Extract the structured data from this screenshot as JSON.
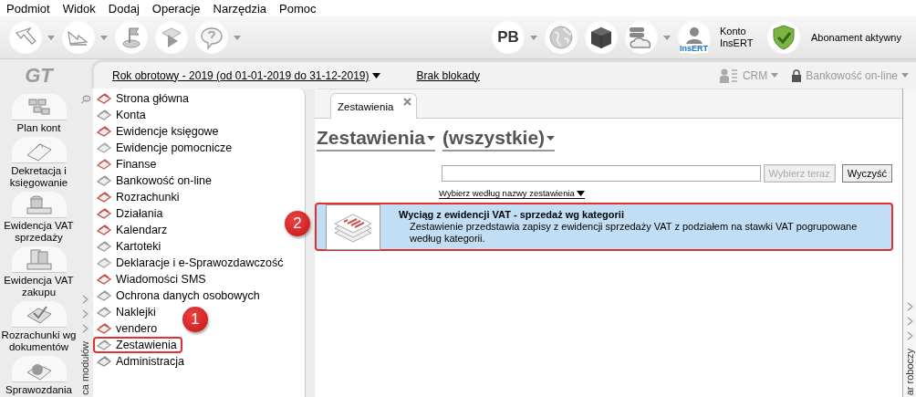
{
  "menu": [
    "Podmiot",
    "Widok",
    "Dodaj",
    "Operacje",
    "Narzędzia",
    "Pomoc"
  ],
  "toolbar": {
    "left": [
      {
        "kind": "send",
        "dropdown": true
      },
      {
        "kind": "receive",
        "dropdown": true
      },
      {
        "kind": "flag",
        "dropdown": false
      },
      {
        "kind": "play",
        "dropdown": false
      },
      {
        "kind": "help",
        "dropdown": true
      }
    ],
    "right": [
      {
        "kind": "text",
        "label": "PB",
        "dropdown": true
      },
      {
        "kind": "globe",
        "dropdown": false
      },
      {
        "kind": "cube",
        "dropdown": false
      },
      {
        "kind": "cloud",
        "dropdown": true
      }
    ],
    "account": {
      "badge": "InsERT",
      "label": "Konto InsERT"
    },
    "subscription": {
      "label": "Abonament aktywny"
    }
  },
  "logo": "GT",
  "period": "Rok obrotowy - 2019 (od 01-01-2019 do 31-12-2019)",
  "lock": "Brak blokady",
  "crm": "CRM",
  "banking": "Bankowość on-line",
  "shortcuts": [
    {
      "label": "Plan kont"
    },
    {
      "label": "Dekretacja i księgowanie"
    },
    {
      "label": "Ewidencja VAT sprzedaży"
    },
    {
      "label": "Ewidencja VAT zakupu"
    },
    {
      "label": "Rozrachunki wg dokumentów"
    },
    {
      "label": "Sprawozdania"
    }
  ],
  "module_panel_label": "ca modułów",
  "modules": [
    {
      "label": "Strona główna",
      "selected": false
    },
    {
      "label": "Konta",
      "selected": false
    },
    {
      "label": "Ewidencje księgowe",
      "selected": false
    },
    {
      "label": "Ewidencje pomocnicze",
      "selected": false
    },
    {
      "label": "Finanse",
      "selected": false
    },
    {
      "label": "Bankowość on-line",
      "selected": false
    },
    {
      "label": "Rozrachunki",
      "selected": false
    },
    {
      "label": "Działania",
      "selected": false
    },
    {
      "label": "Kalendarz",
      "selected": false
    },
    {
      "label": "Kartoteki",
      "selected": false
    },
    {
      "label": "Deklaracje i e-Sprawozdawczość",
      "selected": false
    },
    {
      "label": "Wiadomości SMS",
      "selected": false
    },
    {
      "label": "Ochrona danych osobowych",
      "selected": false
    },
    {
      "label": "Naklejki",
      "selected": false
    },
    {
      "label": "vendero",
      "selected": false
    },
    {
      "label": "Zestawienia",
      "selected": true
    },
    {
      "label": "Administracja",
      "selected": false
    }
  ],
  "tabs": [
    {
      "label": "Zestawienia",
      "selected": true
    }
  ],
  "heading": {
    "category": "Zestawienia",
    "filter": "(wszystkie)"
  },
  "buttons": [
    {
      "label": "Wybierz teraz",
      "disabled": true
    },
    {
      "label": "Wyczyść",
      "disabled": false
    }
  ],
  "sort_link": "Wybierz według nazwy zestawienia",
  "results": [
    {
      "title": "Wyciąg z ewidencji VAT - sprzedaż wg kategorii",
      "description": "Zestawienie przedstawia zapisy z ewidencji sprzedaży VAT z podziałem na stawki VAT pogrupowane według kategorii.",
      "selected": true
    }
  ],
  "workspace_label": "ar roboczy",
  "annotations": [
    {
      "label": "1"
    },
    {
      "label": "2"
    }
  ]
}
